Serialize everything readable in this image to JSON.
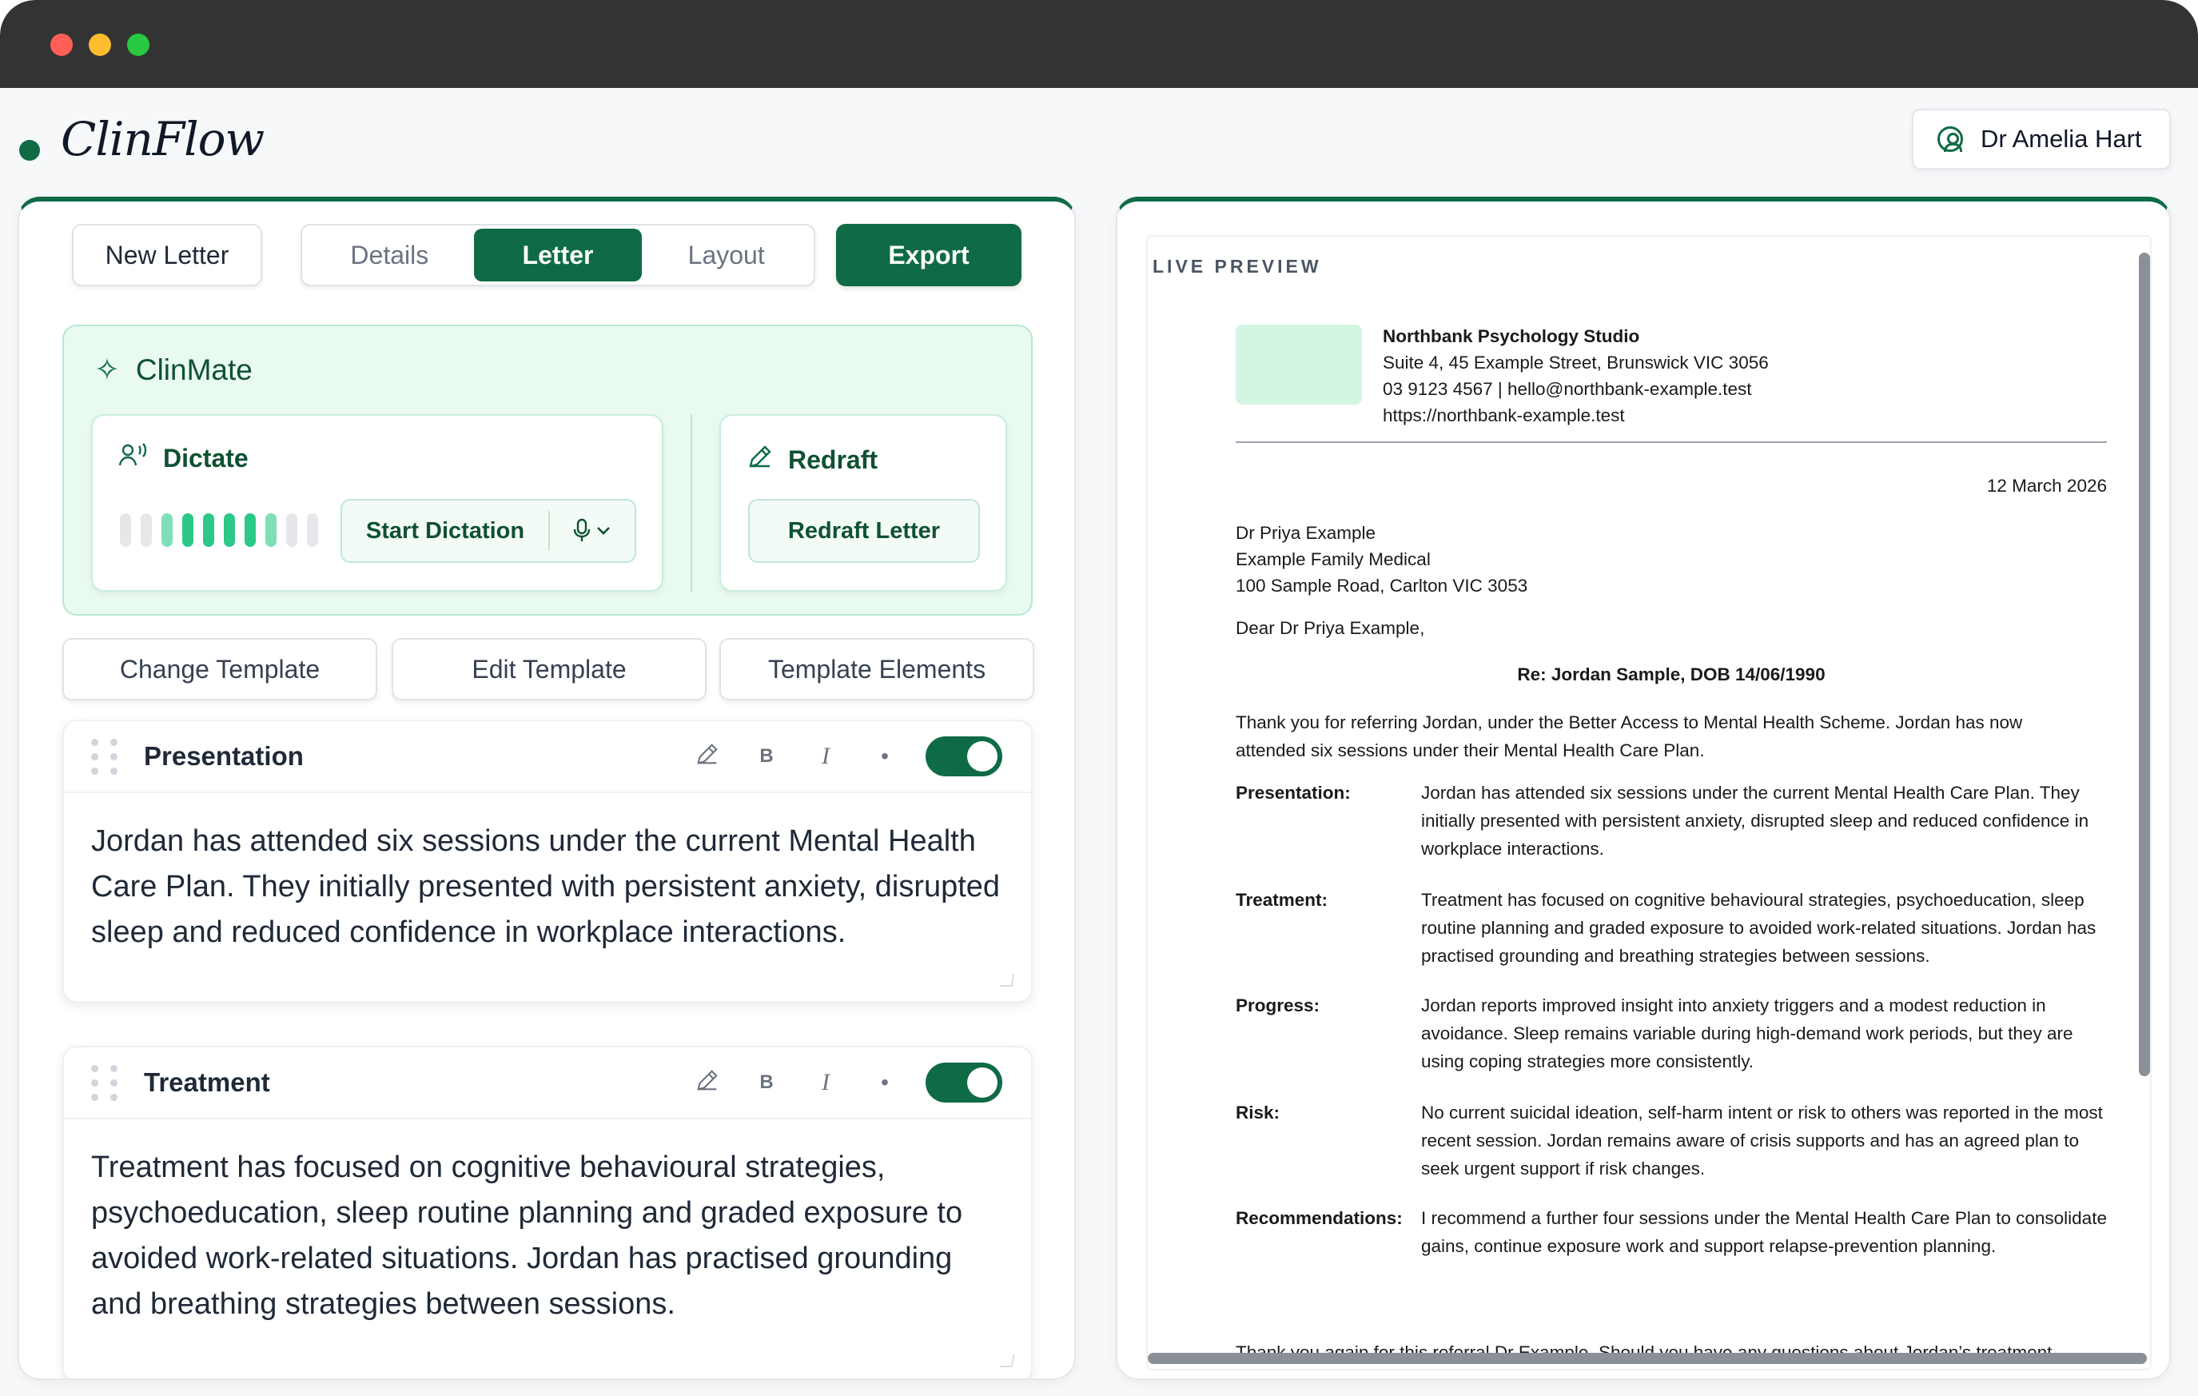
{
  "app": {
    "brand": "ClinFlow",
    "user": "Dr Amelia Hart"
  },
  "toolbar": {
    "new_letter": "New Letter",
    "tabs": [
      "Details",
      "Letter",
      "Layout"
    ],
    "active_tab": "Letter",
    "export": "Export"
  },
  "clinmate": {
    "title": "ClinMate",
    "dictate_title": "Dictate",
    "start_dictation": "Start Dictation",
    "redraft_title": "Redraft",
    "redraft_button": "Redraft Letter"
  },
  "template_buttons": [
    "Change Template",
    "Edit Template",
    "Template Elements"
  ],
  "sections": [
    {
      "title": "Presentation",
      "enabled": true,
      "body": "Jordan has attended six sessions under the current Mental Health Care Plan. They initially presented with persistent anxiety, disrupted sleep and reduced confidence in workplace interactions."
    },
    {
      "title": "Treatment",
      "enabled": true,
      "body": "Treatment has focused on cognitive behavioural strategies, psychoeducation, sleep routine planning and graded exposure to avoided work-related situations. Jordan has practised grounding and breathing strategies between sessions."
    }
  ],
  "formatting": {
    "bold": "B",
    "italic": "I",
    "bullet": "•"
  },
  "preview": {
    "label": "LIVE PREVIEW",
    "org_name": "Northbank Psychology Studio",
    "org_address": "Suite 4, 45 Example Street, Brunswick VIC 3056",
    "org_contact": "03 9123 4567 | hello@northbank-example.test",
    "org_web": "https://northbank-example.test",
    "date": "12 March 2026",
    "recipient": [
      "Dr Priya Example",
      "Example Family Medical",
      "100 Sample Road, Carlton VIC 3053"
    ],
    "salutation": "Dear Dr Priya Example,",
    "re": "Re: Jordan Sample, DOB 14/06/1990",
    "intro": "Thank you for referring Jordan, under the Better Access to Mental Health Scheme. Jordan has now attended six sessions under their Mental Health Care Plan.",
    "rows": [
      {
        "label": "Presentation:",
        "text": "Jordan has attended six sessions under the current Mental Health Care Plan. They initially presented with persistent anxiety, disrupted sleep and reduced confidence in workplace interactions."
      },
      {
        "label": "Treatment:",
        "text": "Treatment has focused on cognitive behavioural strategies, psychoeducation, sleep routine planning and graded exposure to avoided work-related situations. Jordan has practised grounding and breathing strategies between sessions."
      },
      {
        "label": "Progress:",
        "text": "Jordan reports improved insight into anxiety triggers and a modest reduction in avoidance. Sleep remains variable during high-demand work periods, but they are using coping strategies more consistently."
      },
      {
        "label": "Risk:",
        "text": "No current suicidal ideation, self-harm intent or risk to others was reported in the most recent session. Jordan remains aware of crisis supports and has an agreed plan to seek urgent support if risk changes."
      },
      {
        "label": "Recommendations:",
        "text": "I recommend a further four sessions under the Mental Health Care Plan to consolidate gains, continue exposure work and support relapse-prevention planning."
      }
    ],
    "closing": "Thank you again for this referral Dr Example. Should you have any questions about Jordan’s treatment, please don’t hesitate to contact me."
  },
  "colors": {
    "accent": "#0f6b45",
    "accent_light": "#e9faf1"
  }
}
